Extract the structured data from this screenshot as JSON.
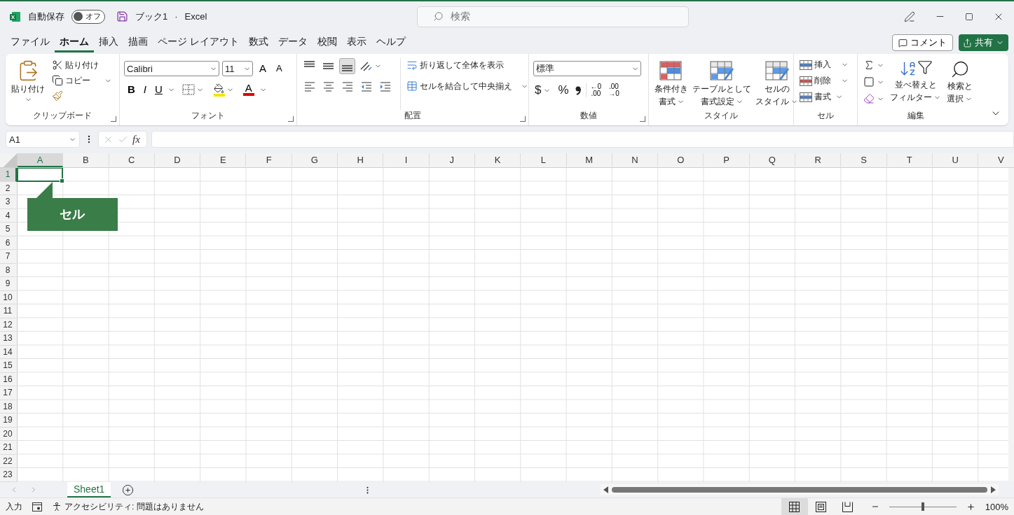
{
  "title_bar": {
    "autosave_label": "自動保存",
    "autosave": {
      "label": "オフ",
      "on": false
    },
    "document": "ブック1",
    "separator": "·",
    "app": "Excel",
    "search": {
      "placeholder": "検索"
    }
  },
  "menu_tabs": [
    {
      "label": "ファイル",
      "selected": false
    },
    {
      "label": "ホーム",
      "selected": true
    },
    {
      "label": "挿入",
      "selected": false
    },
    {
      "label": "描画",
      "selected": false
    },
    {
      "label": "ページ レイアウト",
      "selected": false
    },
    {
      "label": "数式",
      "selected": false
    },
    {
      "label": "データ",
      "selected": false
    },
    {
      "label": "校閲",
      "selected": false
    },
    {
      "label": "表示",
      "selected": false
    },
    {
      "label": "ヘルプ",
      "selected": false
    }
  ],
  "comment_button": "コメント",
  "share_button": "共有",
  "ribbon": {
    "clipboard": {
      "paste": "貼り付け",
      "cut": "貼り付け",
      "copy": "コピー",
      "label": "クリップボード"
    },
    "font": {
      "name": "Calibri",
      "size": "11",
      "grow": "A",
      "shrink": "A",
      "bold": "B",
      "italic": "I",
      "underline": "U",
      "color_letter": "A",
      "label": "フォント"
    },
    "alignment": {
      "vertical": [
        {
          "selected": false
        },
        {
          "selected": false
        },
        {
          "selected": true
        }
      ],
      "wrap": "折り返して全体を表示",
      "merge": "セルを結合して中央揃え",
      "label": "配置"
    },
    "number": {
      "format": "標準",
      "currency": "$",
      "percent": "%",
      "increase_decimal": {
        "top": "←0",
        "bottom": ".00"
      },
      "decrease_decimal": {
        "top": ".00",
        "bottom": "→0"
      },
      "label": "数値"
    },
    "styles": {
      "buttons": [
        {
          "kind": "conditional",
          "lines": [
            "条件付き",
            "書式"
          ]
        },
        {
          "kind": "table",
          "lines": [
            "テーブルとして",
            "書式設定"
          ]
        },
        {
          "kind": "cell",
          "lines": [
            "セルの",
            "スタイル"
          ]
        }
      ],
      "label": "スタイル"
    },
    "cells": {
      "buttons": [
        {
          "kind": "insert",
          "label": "挿入"
        },
        {
          "kind": "delete",
          "label": "削除"
        },
        {
          "kind": "format",
          "label": "書式"
        }
      ],
      "label": "セル"
    },
    "editing": {
      "sort": [
        "並べ替えと",
        "フィルター"
      ],
      "find": [
        "検索と",
        "選択"
      ],
      "label": "編集"
    }
  },
  "formula_bar": {
    "name_box": "A1",
    "fx": "fx"
  },
  "columns": [
    {
      "label": "A",
      "selected": true
    },
    {
      "label": "B",
      "selected": false
    },
    {
      "label": "C",
      "selected": false
    },
    {
      "label": "D",
      "selected": false
    },
    {
      "label": "E",
      "selected": false
    },
    {
      "label": "F",
      "selected": false
    },
    {
      "label": "G",
      "selected": false
    },
    {
      "label": "H",
      "selected": false
    },
    {
      "label": "I",
      "selected": false
    },
    {
      "label": "J",
      "selected": false
    },
    {
      "label": "K",
      "selected": false
    },
    {
      "label": "L",
      "selected": false
    },
    {
      "label": "M",
      "selected": false
    },
    {
      "label": "N",
      "selected": false
    },
    {
      "label": "O",
      "selected": false
    },
    {
      "label": "P",
      "selected": false
    },
    {
      "label": "Q",
      "selected": false
    },
    {
      "label": "R",
      "selected": false
    },
    {
      "label": "S",
      "selected": false
    },
    {
      "label": "T",
      "selected": false
    },
    {
      "label": "U",
      "selected": false
    },
    {
      "label": "V",
      "selected": false
    }
  ],
  "rows": [
    {
      "label": "1",
      "selected": true
    },
    {
      "label": "2",
      "selected": false
    },
    {
      "label": "3",
      "selected": false
    },
    {
      "label": "4",
      "selected": false
    },
    {
      "label": "5",
      "selected": false
    },
    {
      "label": "6",
      "selected": false
    },
    {
      "label": "7",
      "selected": false
    },
    {
      "label": "8",
      "selected": false
    },
    {
      "label": "9",
      "selected": false
    },
    {
      "label": "10",
      "selected": false
    },
    {
      "label": "11",
      "selected": false
    },
    {
      "label": "12",
      "selected": false
    },
    {
      "label": "13",
      "selected": false
    },
    {
      "label": "14",
      "selected": false
    },
    {
      "label": "15",
      "selected": false
    },
    {
      "label": "16",
      "selected": false
    },
    {
      "label": "17",
      "selected": false
    },
    {
      "label": "18",
      "selected": false
    },
    {
      "label": "19",
      "selected": false
    },
    {
      "label": "20",
      "selected": false
    },
    {
      "label": "21",
      "selected": false
    },
    {
      "label": "22",
      "selected": false
    },
    {
      "label": "23",
      "selected": false
    }
  ],
  "callout": "セル",
  "sheet_tabs": [
    {
      "label": "Sheet1",
      "selected": true
    }
  ],
  "status_bar": {
    "mode": "入力",
    "accessibility": "アクセシビリティ: 問題はありません",
    "views": [
      {
        "kind": "normal",
        "selected": true
      },
      {
        "kind": "page_layout",
        "selected": false
      },
      {
        "kind": "page_break",
        "selected": false
      }
    ],
    "zoom": {
      "level": 0.5
    },
    "zoom_label": "100%"
  }
}
